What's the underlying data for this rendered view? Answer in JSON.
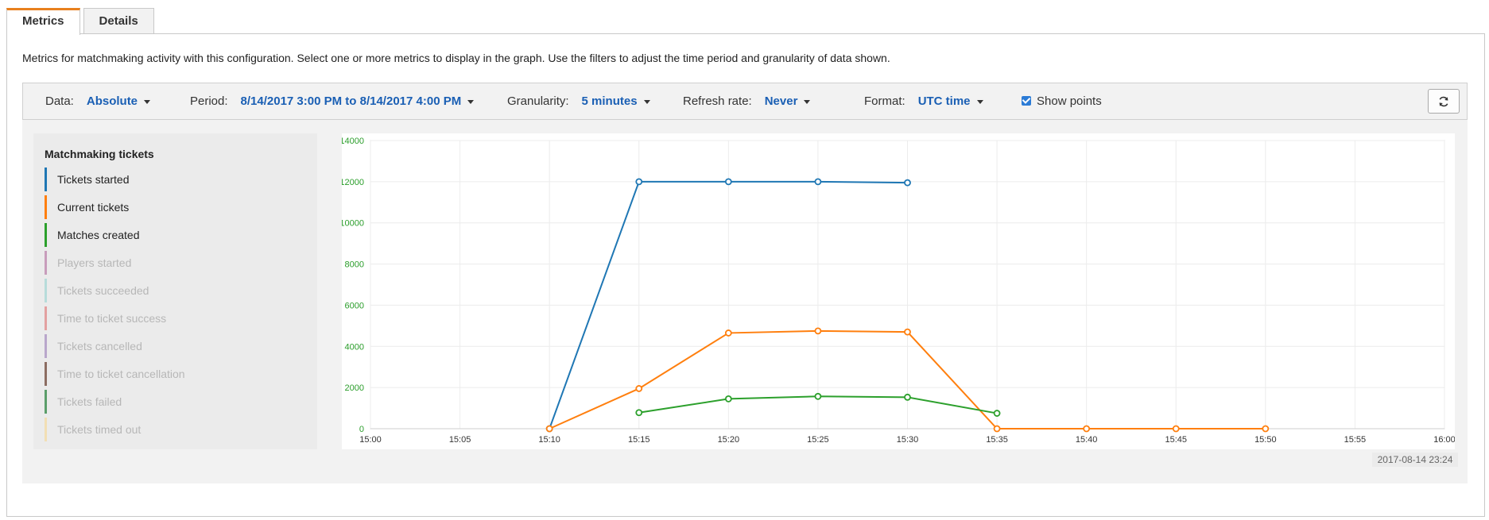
{
  "tabs": [
    {
      "label": "Metrics",
      "active": true
    },
    {
      "label": "Details",
      "active": false
    }
  ],
  "intro": "Metrics for matchmaking activity with this configuration. Select one or more metrics to display in the graph. Use the filters to adjust the time period and granularity of data shown.",
  "filters": {
    "data": {
      "label": "Data:",
      "value": "Absolute"
    },
    "period": {
      "label": "Period:",
      "value": "8/14/2017 3:00 PM to 8/14/2017 4:00 PM"
    },
    "granularity": {
      "label": "Granularity:",
      "value": "5 minutes"
    },
    "refresh_rate": {
      "label": "Refresh rate:",
      "value": "Never"
    },
    "format": {
      "label": "Format:",
      "value": "UTC time"
    },
    "show_points": {
      "label": "Show points",
      "checked": true
    }
  },
  "refresh_icon": "refresh-icon",
  "legend": {
    "title": "Matchmaking tickets",
    "items": [
      {
        "label": "Tickets started",
        "color": "#1f77b4",
        "active": true
      },
      {
        "label": "Current tickets",
        "color": "#ff7f0e",
        "active": true
      },
      {
        "label": "Matches created",
        "color": "#2ca02c",
        "active": true
      },
      {
        "label": "Players started",
        "color": "#c89dbb",
        "active": false
      },
      {
        "label": "Tickets succeeded",
        "color": "#b7dcda",
        "active": false
      },
      {
        "label": "Time to ticket success",
        "color": "#e3a0a0",
        "active": false
      },
      {
        "label": "Tickets cancelled",
        "color": "#b9a7cb",
        "active": false
      },
      {
        "label": "Time to ticket cancellation",
        "color": "#8c6d62",
        "active": false
      },
      {
        "label": "Tickets failed",
        "color": "#5b9e6a",
        "active": false
      },
      {
        "label": "Tickets timed out",
        "color": "#f2dfb4",
        "active": false
      }
    ]
  },
  "timestamp": "2017-08-14 23:24",
  "chart_data": {
    "type": "line",
    "x": [
      "15:00",
      "15:05",
      "15:10",
      "15:15",
      "15:20",
      "15:25",
      "15:30",
      "15:35",
      "15:40",
      "15:45",
      "15:50",
      "15:55",
      "16:00"
    ],
    "ylim": [
      0,
      14000
    ],
    "yticks": [
      0,
      2000,
      4000,
      6000,
      8000,
      10000,
      12000,
      14000
    ],
    "grid": true,
    "series": [
      {
        "name": "Tickets started",
        "color": "#1f77b4",
        "points": [
          [
            "15:10",
            0
          ],
          [
            "15:15",
            12000
          ],
          [
            "15:20",
            12000
          ],
          [
            "15:25",
            12000
          ],
          [
            "15:30",
            11950
          ]
        ]
      },
      {
        "name": "Current tickets",
        "color": "#ff7f0e",
        "points": [
          [
            "15:10",
            0
          ],
          [
            "15:15",
            1950
          ],
          [
            "15:20",
            4650
          ],
          [
            "15:25",
            4750
          ],
          [
            "15:30",
            4700
          ],
          [
            "15:35",
            0
          ],
          [
            "15:40",
            0
          ],
          [
            "15:45",
            0
          ],
          [
            "15:50",
            0
          ]
        ]
      },
      {
        "name": "Matches created",
        "color": "#2ca02c",
        "points": [
          [
            "15:15",
            780
          ],
          [
            "15:20",
            1450
          ],
          [
            "15:25",
            1570
          ],
          [
            "15:30",
            1530
          ],
          [
            "15:35",
            750
          ]
        ]
      }
    ]
  }
}
